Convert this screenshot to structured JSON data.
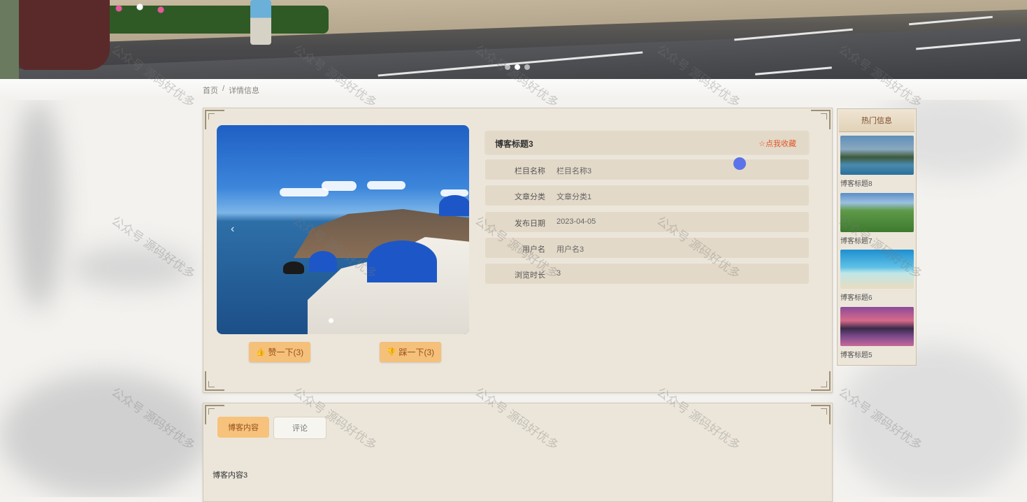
{
  "banner": {
    "slides_total": 3,
    "active_slide": 2
  },
  "breadcrumb": {
    "home": "首页",
    "separator": "/",
    "current": "详情信息"
  },
  "article": {
    "title": "博客标题3",
    "favorite_label": "☆点我收藏",
    "fields": [
      {
        "label": "栏目名称",
        "value": "栏目名称3"
      },
      {
        "label": "文章分类",
        "value": "文章分类1"
      },
      {
        "label": "发布日期",
        "value": "2023-04-05"
      },
      {
        "label": "用户名",
        "value": "用户名3"
      },
      {
        "label": "浏览时长",
        "value": "3"
      }
    ],
    "image_prev": "‹",
    "like_label": "赞一下(3)",
    "dislike_label": "踩一下(3)"
  },
  "sidebar": {
    "title": "热门信息",
    "items": [
      {
        "caption": "博客标题8"
      },
      {
        "caption": "博客标题7"
      },
      {
        "caption": "博客标题6"
      },
      {
        "caption": "博客标题5"
      }
    ]
  },
  "tabs": [
    {
      "label": "博客内容"
    },
    {
      "label": "评论"
    }
  ],
  "content": {
    "text": "博客内容3"
  },
  "watermark": "公众号 源码好优多",
  "colors": {
    "accent": "#f6c27c",
    "favorite": "#e1572b",
    "panel": "#ece6da"
  }
}
